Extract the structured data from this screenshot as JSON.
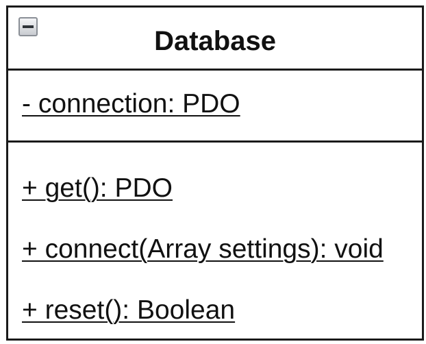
{
  "class": {
    "name": "Database",
    "collapse_icon": "minus-box-icon",
    "attributes": [
      {
        "text": "- connection: PDO"
      }
    ],
    "operations": [
      {
        "text": "+ get(): PDO"
      },
      {
        "text": "+ connect(Array settings): void"
      },
      {
        "text": "+ reset(): Boolean"
      }
    ]
  }
}
